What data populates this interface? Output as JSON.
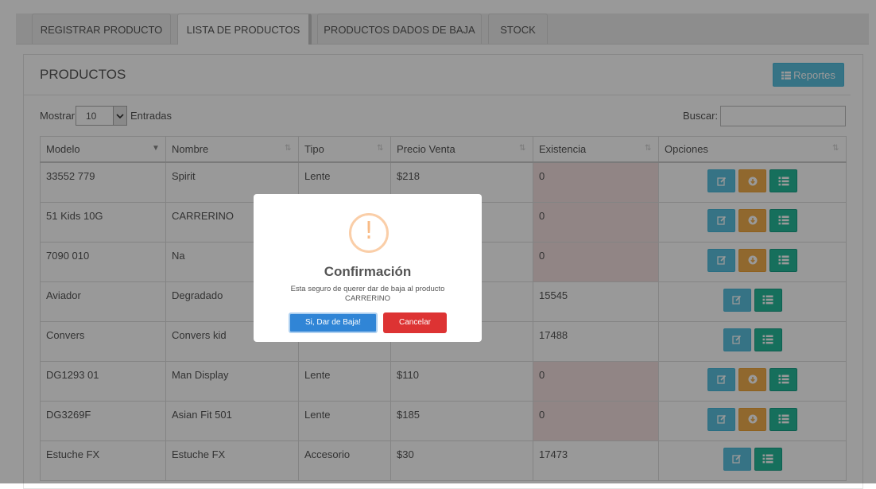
{
  "tabs": [
    {
      "label": "REGISTRAR PRODUCTO"
    },
    {
      "label": "LISTA DE PRODUCTOS"
    },
    {
      "label": "PRODUCTOS DADOS DE BAJA"
    },
    {
      "label": "STOCK"
    }
  ],
  "panel": {
    "title": "PRODUCTOS",
    "reportes_label": "Reportes",
    "show_label": "Mostrar",
    "entries_label": "Entradas",
    "page_size": "10",
    "search_label": "Buscar:",
    "search_value": ""
  },
  "table": {
    "headers": [
      "Modelo",
      "Nombre",
      "Tipo",
      "Precio Venta",
      "Existencia",
      "Opciones"
    ],
    "rows": [
      {
        "modelo": "33552 779",
        "nombre": "Spirit",
        "tipo": "Lente",
        "precio": "$218",
        "existencia": "0"
      },
      {
        "modelo": "51 Kids 10G",
        "nombre": "CARRERINO",
        "tipo": "",
        "precio": "",
        "existencia": "0"
      },
      {
        "modelo": "7090 010",
        "nombre": "Na",
        "tipo": "",
        "precio": "",
        "existencia": "0"
      },
      {
        "modelo": "Aviador",
        "nombre": "Degradado",
        "tipo": "",
        "precio": "",
        "existencia": "15545"
      },
      {
        "modelo": "Convers",
        "nombre": "Convers kid",
        "tipo": "",
        "precio": "",
        "existencia": "17488"
      },
      {
        "modelo": "DG1293 01",
        "nombre": "Man Display",
        "tipo": "Lente",
        "precio": "$110",
        "existencia": "0"
      },
      {
        "modelo": "DG3269F",
        "nombre": "Asian Fit 501",
        "tipo": "Lente",
        "precio": "$185",
        "existencia": "0"
      },
      {
        "modelo": "Estuche FX",
        "nombre": "Estuche FX",
        "tipo": "Accesorio",
        "precio": "$30",
        "existencia": "17473"
      }
    ]
  },
  "modal": {
    "icon": "!",
    "title": "Confirmación",
    "text": "Esta seguro de querer dar de baja al producto CARRERINO",
    "confirm_label": "Si, Dar de Baja!",
    "cancel_label": "Cancelar"
  },
  "colors": {
    "info": "#5bc0de",
    "warning": "#f0ad4e",
    "success": "#26b99a",
    "zero_stock_bg": "#f2dede",
    "confirm": "#3085d6",
    "cancel": "#dd3333"
  }
}
